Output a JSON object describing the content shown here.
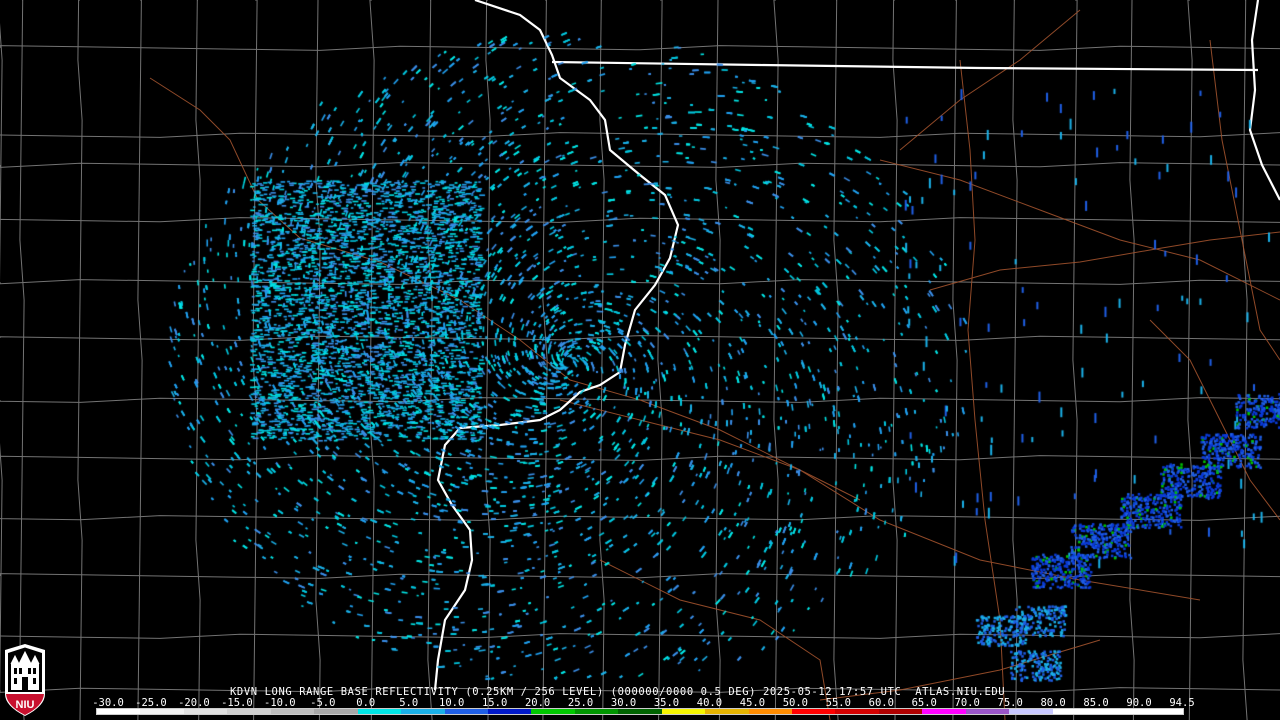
{
  "product": {
    "caption": "KDVN LONG RANGE BASE REFLECTIVITY (0.25KM / 256 LEVEL) (000000/0000 0.5 DEG) 2025-05-12 17:57 UTC  ATLAS.NIU.EDU"
  },
  "legend": {
    "labels": [
      "-30.0",
      "-25.0",
      "-20.0",
      "-15.0",
      "-10.0",
      "-5.0",
      "0.0",
      "5.0",
      "10.0",
      "15.0",
      "20.0",
      "25.0",
      "30.0",
      "35.0",
      "40.0",
      "45.0",
      "50.0",
      "55.0",
      "60.0",
      "65.0",
      "70.0",
      "75.0",
      "80.0",
      "85.0",
      "90.0",
      "94.5"
    ],
    "colors": [
      "#ffffff",
      "#f0f0f0",
      "#e0e0e0",
      "#cfcfcf",
      "#bdbdbd",
      "#a8a8a8",
      "#00e5e5",
      "#1ab0e8",
      "#1f5fe6",
      "#0018c8",
      "#00c800",
      "#009600",
      "#006400",
      "#f5f500",
      "#e6b400",
      "#ff8c00",
      "#ff0000",
      "#d40000",
      "#b00000",
      "#ff00ff",
      "#9a55c8",
      "#c8c8ff",
      "#ffffff",
      "#ffffff",
      "#ffffff"
    ]
  },
  "logo": {
    "text": "NIU",
    "color": "#c8102e"
  },
  "map_colors": {
    "background": "#000000",
    "county_lines": "#9a9a9a",
    "state_lines": "#ffffff",
    "roads": "#a0522d"
  }
}
